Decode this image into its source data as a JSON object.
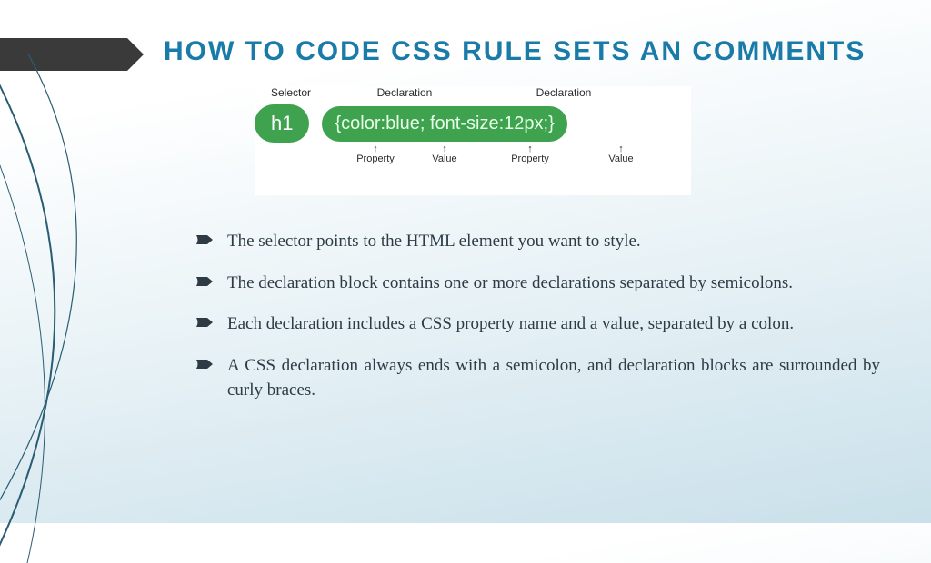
{
  "title": "How to code CSS rule sets an comments",
  "diagram": {
    "top": {
      "selector": "Selector",
      "decl1": "Declaration",
      "decl2": "Declaration"
    },
    "selector_pill": "h1",
    "decl_pill": "{color:blue; font-size:12px;}",
    "bottom": {
      "p1": "Property",
      "v1": "Value",
      "p2": "Property",
      "v2": "Value"
    }
  },
  "bullets": [
    "The selector points to the HTML element you want to style.",
    "The declaration block contains one or more declarations separated by semicolons.",
    "Each declaration includes a CSS property name and a value, separated by a colon.",
    "A CSS declaration always ends with a semicolon, and declaration blocks are surrounded by curly braces."
  ]
}
